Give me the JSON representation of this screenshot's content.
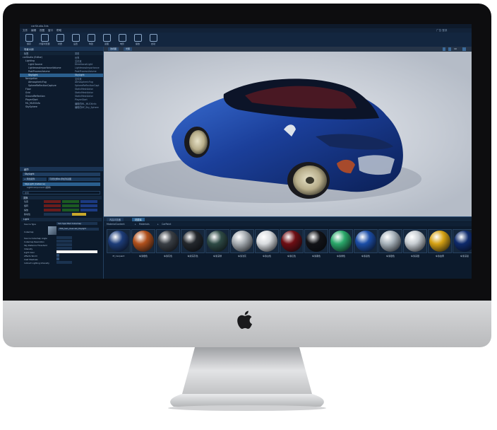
{
  "window": {
    "title": "carStudio.3ds"
  },
  "menubar": {
    "items": [
      "文件",
      "编辑",
      "视图",
      "窗口",
      "帮助"
    ],
    "right_text": "广告·登录"
  },
  "toolbar": {
    "items": [
      "保存",
      "内容浏览器",
      "材质",
      "设置",
      "构建",
      "蓝图",
      "电影",
      "播放",
      "启动"
    ]
  },
  "outliner": {
    "title": "场景大纲",
    "col_label": "标签",
    "col_type": "类型",
    "rows": [
      {
        "label": "carStudio (Editor)",
        "type": "世界"
      },
      {
        "label": "Lighting",
        "type": "文件夹"
      },
      {
        "label": "Light Source",
        "type": "DirectionalLight"
      },
      {
        "label": "LightmassImportanceVolume",
        "type": "LightmassImportance"
      },
      {
        "label": "PostProcessVolume",
        "type": "PostProcessVolume"
      },
      {
        "label": "SkyLight",
        "type": "SkyLight"
      },
      {
        "label": "Navigation",
        "type": "文件夹"
      },
      {
        "label": "AtmosphericFog",
        "type": "AtmosphericFog"
      },
      {
        "label": "SphereReflectionCapture",
        "type": "SphereReflectionCapt"
      },
      {
        "label": "Floor",
        "type": "StaticMeshActor"
      },
      {
        "label": "Grid",
        "type": "StaticMeshActor"
      },
      {
        "label": "GroundReflection",
        "type": "StaticMeshActor"
      },
      {
        "label": "PlayerStart",
        "type": "PlayerStart"
      },
      {
        "label": "ML_MLEXInfo",
        "type": "编辑的ML_MLEXInfo"
      },
      {
        "label": "SkySphere",
        "type": "编辑的BP_Sky_Sphere"
      }
    ],
    "footer_count": "15个对象（1个被选中）",
    "view_options": "视图选项"
  },
  "details": {
    "tab": "细节",
    "name_value": "SkyLight",
    "add_component": "+ 添加组件",
    "blueprint_button": "可视化脚本/添加到蓝图",
    "comp_root": "SkyLight (Instance)",
    "comp_child": "LightComponent (继承)",
    "search_placeholder": "搜索",
    "section_transform": "变换",
    "location_label": "位置",
    "rotation_label": "旋转",
    "scale_label": "缩放",
    "mobility_label": "移动性",
    "section_light": "Light",
    "source_type_label": "Source Type",
    "source_type_value": "SLS Specified Cubemap",
    "cubemap_label": "Cubemap",
    "cubemap_value": "HDR_Sam_Overcast_Daylight",
    "angle_label": "Source Cubemap Angle",
    "resolution_label": "Cubemap Resolution",
    "sky_distance_label": "Sky Distance Threshold",
    "intensity_label": "Intensity",
    "light_color_label": "Light Color",
    "affects_world_label": "Affects World",
    "cast_shadows_label": "Cast Shadows",
    "indirect_label": "Indirect Lighting Intensity"
  },
  "viewport": {
    "left_buttons": [
      "透视图",
      "光照"
    ],
    "right_label": "10"
  },
  "content_browser": {
    "tabs": [
      "内容浏览器",
      "材质库"
    ],
    "path": [
      "MaterialContent",
      "Materials",
      "CarPaint"
    ],
    "materials": [
      {
        "name": "M_Carpaint",
        "color": "#1d3d7a"
      },
      {
        "name": "车漆橙色",
        "color": "#b0501c"
      },
      {
        "name": "车漆灰色",
        "color": "#3a3f45"
      },
      {
        "name": "车漆深灰色",
        "color": "#23272c"
      },
      {
        "name": "车漆深绿",
        "color": "#2e4a45"
      },
      {
        "name": "车漆浅灰",
        "color": "#a7adb2"
      },
      {
        "name": "车漆白色",
        "color": "#d9dcdf"
      },
      {
        "name": "车漆红色",
        "color": "#6e0e14"
      },
      {
        "name": "车漆黑色",
        "color": "#121317"
      },
      {
        "name": "车漆绿色",
        "color": "#2aa86a"
      },
      {
        "name": "车漆蓝色",
        "color": "#1c4ea8"
      },
      {
        "name": "车漆银色",
        "color": "#a9b4bc"
      },
      {
        "name": "车漆亮银",
        "color": "#c7cdd2"
      },
      {
        "name": "车漆金黄",
        "color": "#d6a214"
      },
      {
        "name": "车漆深蓝",
        "color": "#0e2a6c"
      }
    ]
  },
  "colors": {
    "accent": "#2a5f8e",
    "car_paint": "#1b3f9a",
    "bezel": "#0d0d0f"
  }
}
